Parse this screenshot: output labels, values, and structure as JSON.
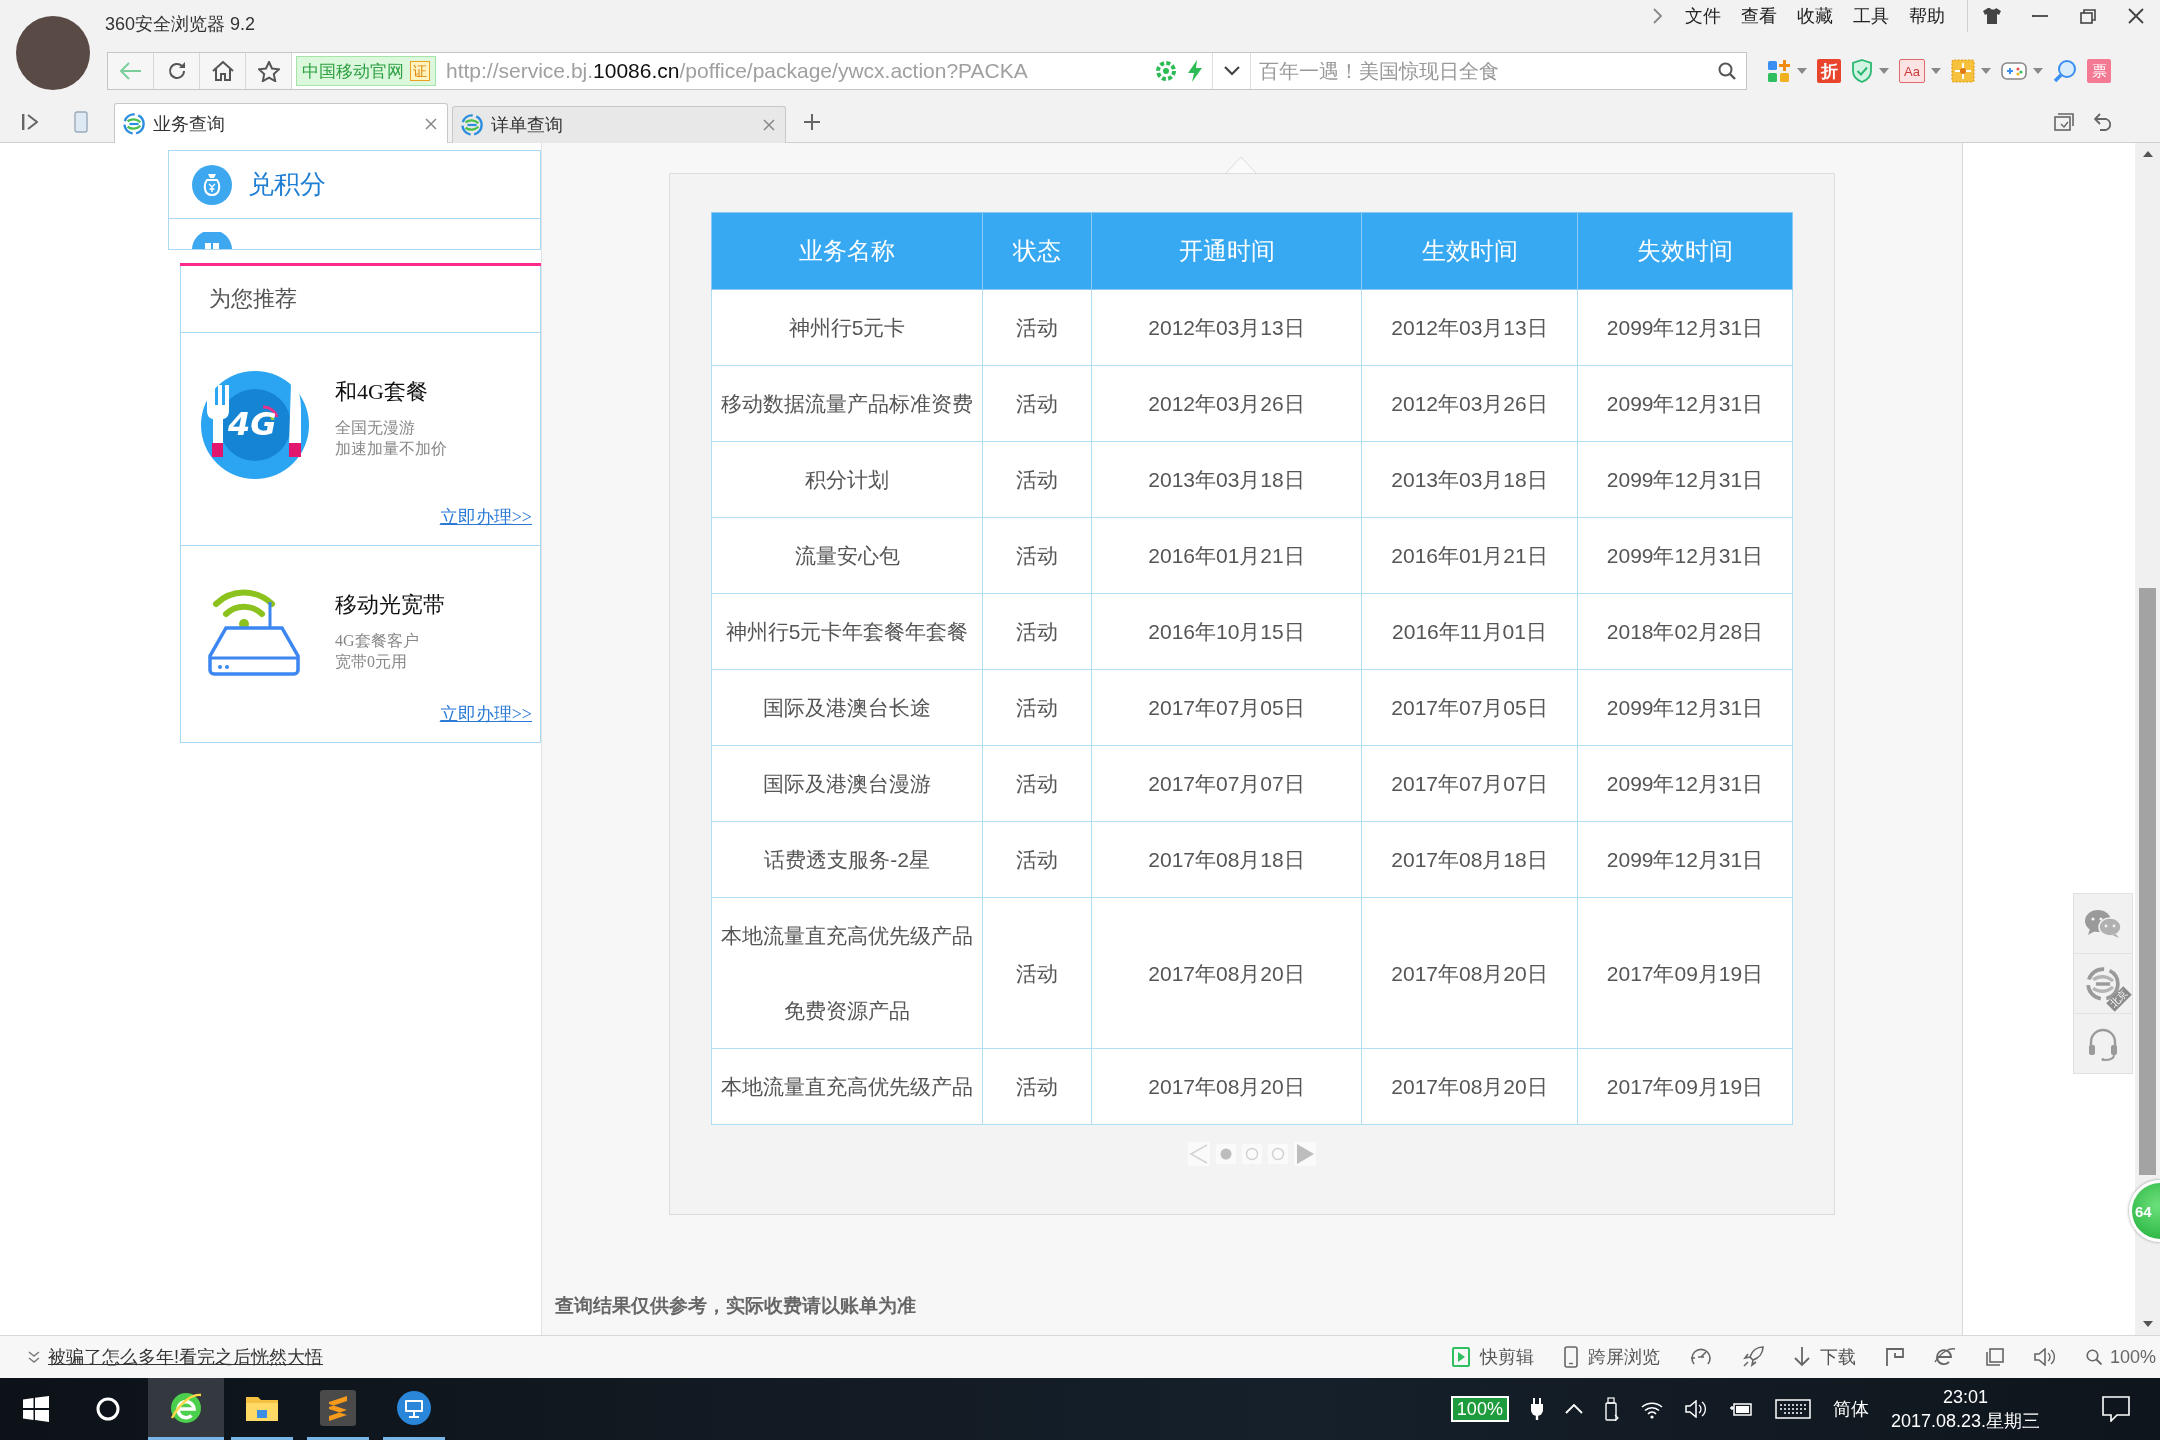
{
  "window": {
    "title": "360安全浏览器 9.2",
    "menu": [
      "文件",
      "查看",
      "收藏",
      "工具",
      "帮助"
    ]
  },
  "address_bar": {
    "site_badge": "中国移动官网",
    "cert_badge": "证",
    "url": "http://service.bj.**10086.cn**/poffice/package/ywcx.action?PACKA",
    "search": {
      "placeholder": "百年一遇！美国惊现日全食"
    }
  },
  "extensions": [
    {
      "kind": "apps",
      "dropdown": true
    },
    {
      "kind": "discount",
      "label": "折",
      "dropdown": false
    },
    {
      "kind": "shield",
      "dropdown": true
    },
    {
      "kind": "font",
      "label": "Aa",
      "dropdown": true
    },
    {
      "kind": "gift",
      "dropdown": true
    },
    {
      "kind": "game",
      "dropdown": true
    },
    {
      "kind": "lens",
      "dropdown": false
    },
    {
      "kind": "ticket",
      "label": "票",
      "dropdown": false
    }
  ],
  "tabs": [
    {
      "label": "业务查询",
      "selected": true
    },
    {
      "label": "详单查询",
      "selected": false
    }
  ],
  "sidebar": {
    "items": [
      {
        "kind": "bag",
        "label": "兑积分"
      },
      {
        "kind": "grid"
      }
    ],
    "recommend": {
      "title": "为您推荐",
      "offers": [
        {
          "kind": "plate",
          "badge": "4G",
          "title": "和4G套餐",
          "lines": [
            "全国无漫游",
            "加速加量不加价"
          ],
          "link": "立即办理>>"
        },
        {
          "kind": "router",
          "title": "移动光宽带",
          "lines": [
            "4G套餐客户",
            "宽带0元用"
          ],
          "link": "立即办理>>"
        }
      ]
    }
  },
  "table": {
    "columns": [
      "业务名称",
      "状态",
      "开通时间",
      "生效时间",
      "失效时间"
    ],
    "rows": [
      [
        "神州行5元卡",
        "活动",
        "2012年03月13日",
        "2012年03月13日",
        "2099年12月31日"
      ],
      [
        "移动数据流量产品标准资费",
        "活动",
        "2012年03月26日",
        "2012年03月26日",
        "2099年12月31日"
      ],
      [
        "积分计划",
        "活动",
        "2013年03月18日",
        "2013年03月18日",
        "2099年12月31日"
      ],
      [
        "流量安心包",
        "活动",
        "2016年01月21日",
        "2016年01月21日",
        "2099年12月31日"
      ],
      [
        "神州行5元卡年套餐年套餐",
        "活动",
        "2016年10月15日",
        "2016年11月01日",
        "2018年02月28日"
      ],
      [
        "国际及港澳台长途",
        "活动",
        "2017年07月05日",
        "2017年07月05日",
        "2099年12月31日"
      ],
      [
        "国际及港澳台漫游",
        "活动",
        "2017年07月07日",
        "2017年07月07日",
        "2099年12月31日"
      ],
      [
        "话费透支服务-2星",
        "活动",
        "2017年08月18日",
        "2017年08月18日",
        "2099年12月31日"
      ],
      [
        [
          "本地流量直充高优先级产品",
          "免费资源产品"
        ],
        "活动",
        "2017年08月20日",
        "2017年08月20日",
        "2017年09月19日"
      ],
      [
        "本地流量直充高优先级产品",
        "活动",
        "2017年08月20日",
        "2017年08月20日",
        "2017年09月19日"
      ]
    ]
  },
  "pagination": {
    "pages": [
      {
        "selected": true
      },
      {
        "selected": false
      },
      {
        "selected": false
      }
    ]
  },
  "note": "查询结果仅供参考，实际收费请以账单为准",
  "side_tools": [
    {
      "kind": "chat"
    },
    {
      "kind": "logo",
      "ribbon": "北京"
    },
    {
      "kind": "headset"
    }
  ],
  "float_ball": "64",
  "status_bar": {
    "news_link": "被骗了怎么多年!看完之后恍然大悟",
    "tools": [
      {
        "kind": "clip",
        "label": "快剪辑"
      },
      {
        "kind": "devices",
        "label": "跨屏浏览"
      },
      {
        "kind": "gauge"
      },
      {
        "kind": "rocket"
      },
      {
        "kind": "download",
        "label": "下载"
      },
      {
        "kind": "flag"
      },
      {
        "kind": "e-logo"
      },
      {
        "kind": "window"
      },
      {
        "kind": "speaker"
      }
    ],
    "zoom": "100%"
  },
  "taskbar": {
    "apps": [
      {
        "kind": "browser",
        "active": true
      },
      {
        "kind": "folder",
        "active": false
      },
      {
        "kind": "editor",
        "active": false
      },
      {
        "kind": "remote",
        "active": false
      }
    ],
    "battery": "100%",
    "ime": "简体",
    "time": "23:01",
    "date": "2017.08.23.星期三"
  }
}
